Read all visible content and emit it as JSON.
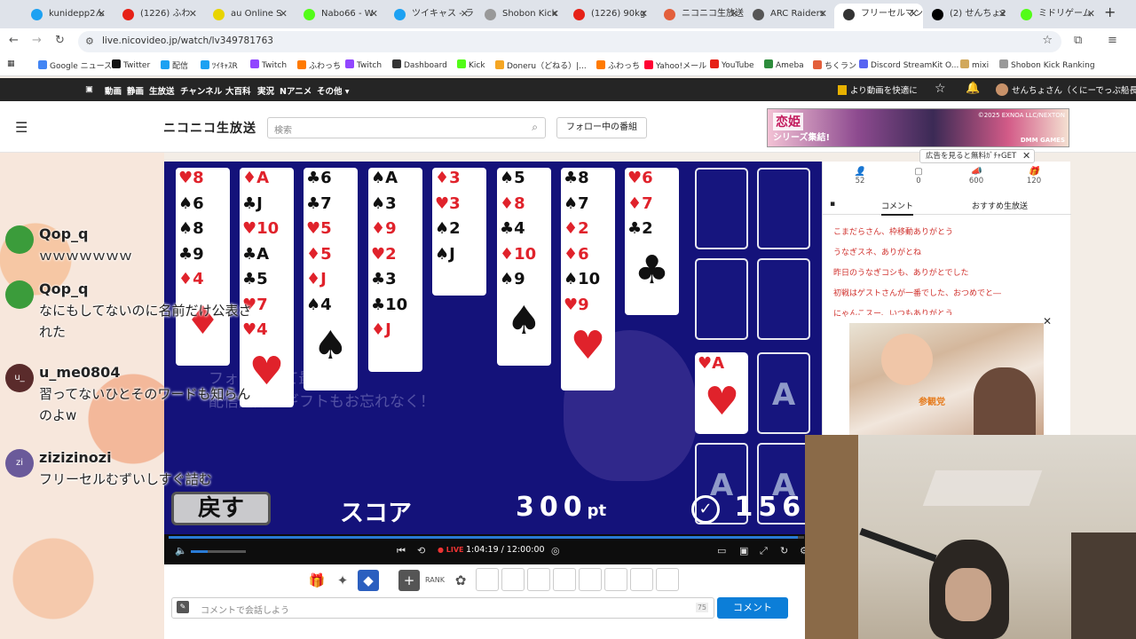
{
  "browser": {
    "tabs": [
      {
        "label": "kunidepp2ん",
        "color": "#1da1f2"
      },
      {
        "label": "(1226) ふわ",
        "color": "#e62117"
      },
      {
        "label": "au Online S",
        "color": "#e8d400"
      },
      {
        "label": "Nabo66 - W",
        "color": "#53fc18"
      },
      {
        "label": "ツイキャス - ラ",
        "color": "#1da1f2"
      },
      {
        "label": "Shobon Kick",
        "color": "#999999"
      },
      {
        "label": "(1226) 90kg",
        "color": "#e62117"
      },
      {
        "label": "ニコニコ生放送",
        "color": "#e35f3b"
      },
      {
        "label": "ARC Raiders",
        "color": "#555555"
      },
      {
        "label": "フリーセルマン",
        "color": "#333333"
      },
      {
        "label": "(2) せんちょ2",
        "color": "#000000"
      },
      {
        "label": "ミドリゲーム",
        "color": "#53fc18"
      }
    ],
    "url": "live.nicovideo.jp/watch/lv349781763",
    "bookmarks": [
      {
        "label": "Google ニュース",
        "color": "#4285f4"
      },
      {
        "label": "Twitter",
        "color": "#111111"
      },
      {
        "label": "配信",
        "color": "#1da1f2"
      },
      {
        "label": "ﾂｲｷｬｽR",
        "color": "#1da1f2"
      },
      {
        "label": "Twitch",
        "color": "#9146ff"
      },
      {
        "label": "ふわっち",
        "color": "#ff7a00"
      },
      {
        "label": "Twitch",
        "color": "#9146ff"
      },
      {
        "label": "Dashboard",
        "color": "#333333"
      },
      {
        "label": "Kick",
        "color": "#53fc18"
      },
      {
        "label": "Doneru（どねる）|...",
        "color": "#f5a623"
      },
      {
        "label": "ふわっち",
        "color": "#ff7a00"
      },
      {
        "label": "Yahoo!メール",
        "color": "#ff0033"
      },
      {
        "label": "YouTube",
        "color": "#e62117"
      },
      {
        "label": "Ameba",
        "color": "#2d8c3c"
      },
      {
        "label": "ちくラン",
        "color": "#e35f3b"
      },
      {
        "label": "Discord StreamKit O...",
        "color": "#5865f2"
      },
      {
        "label": "mixi",
        "color": "#d1a85b"
      },
      {
        "label": "Shobon Kick Ranking",
        "color": "#999999"
      }
    ]
  },
  "nicobar": {
    "items": [
      "動画",
      "静画",
      "生放送",
      "チャンネル",
      "大百科",
      "実況",
      "Nアニメ",
      "その他 ▾"
    ],
    "promo": "より動画を快適に",
    "user": "せんちょさん（くにーでっぷ船長)"
  },
  "site_header": {
    "logo": "ニコニコ生放送",
    "search_placeholder": "検索",
    "follow_button": "フォロー中の番組",
    "ad_title": "恋姫",
    "ad_subtitle": "シリーズ集結!",
    "ad_copyright": "©2025 EXNOA LLC/NEXTON",
    "ad_brand": "DMM GAMES"
  },
  "fan_comments": [
    {
      "name": "Qop_q",
      "text": "ｗｗｗｗｗｗｗ",
      "avatar_color": "#3b9c3b",
      "avatar_text": ""
    },
    {
      "name": "Qop_q",
      "text": "なにもしてないのに名前だけ公表された",
      "avatar_color": "#3b9c3b",
      "avatar_text": ""
    },
    {
      "name": "u_me0804",
      "text": "習ってないひとそのワードも知らんのよw",
      "avatar_color": "#5a2b2b",
      "avatar_text": "u_"
    },
    {
      "name": "zizizinozi",
      "text": "フリーセルむずいしすぐ詰む",
      "avatar_color": "#6a5a9a",
      "avatar_text": "zi"
    }
  ],
  "game": {
    "columns": [
      {
        "ranks": [
          "♥8",
          "♠6",
          "♠8",
          "♣9",
          "♦4"
        ],
        "big": "♦"
      },
      {
        "ranks": [
          "♦A",
          "♣J",
          "♥10",
          "♣A",
          "♣5",
          "♥7",
          "♥4"
        ],
        "big": "♥"
      },
      {
        "ranks": [
          "♣6",
          "♣7",
          "♥5",
          "♦5",
          "♦J",
          "♠4"
        ],
        "big": "♠"
      },
      {
        "ranks": [
          "♠A",
          "♠3",
          "♦9",
          "♥2",
          "♣3",
          "♣10",
          "♦J"
        ],
        "big": ""
      },
      {
        "ranks": [
          "♦3",
          "♥3",
          "♠2",
          "♠J"
        ],
        "big": ""
      },
      {
        "ranks": [
          "♠5",
          "♦8",
          "♣4",
          "♦10",
          "♠9"
        ],
        "big": "♠"
      },
      {
        "ranks": [
          "♣8",
          "♠7",
          "♦2",
          "♦6",
          "♠10",
          "♥9"
        ],
        "big": "♥"
      },
      {
        "ranks": [
          "♥6",
          "♦7",
          "♣2"
        ],
        "big": "♣"
      }
    ],
    "foundation_card": "♥A",
    "slot_label": "A",
    "back_button": "戻す",
    "score_label": "スコア",
    "score_value": "300",
    "score_unit": "pt",
    "timer_value": "156",
    "watermark_line1": "フォローして最新の",
    "watermark_line2": "配信通知＆ギフトもお忘れなく！"
  },
  "player": {
    "live_label": "LIVE",
    "time": "1:04:19 / 12:00:00",
    "progress": 0.99,
    "volume": 0.3
  },
  "comment_box": {
    "placeholder": "コメントで会話しよう",
    "count": "75",
    "send": "コメント"
  },
  "right_panel": {
    "ad_label": "広告を見ると無料ｶﾞﾁｬGET",
    "stats": [
      "52",
      "0",
      "600",
      "120"
    ],
    "tabs": [
      "コメント",
      "おすすめ生放送"
    ],
    "comments": [
      "こまだらさん、枠移動ありがとう",
      "うなぎスネ、ありがとね",
      "昨日のうなぎコシも、ありがとでした",
      "初戦はゲストさんが一番でした、おつめでと―",
      "にゃんこスー、いつもありがとう"
    ],
    "popup_logo": "参観党"
  }
}
